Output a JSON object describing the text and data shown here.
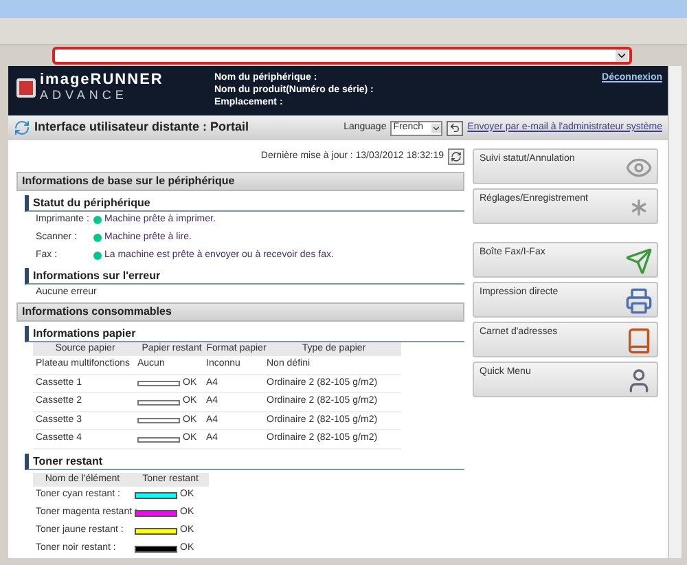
{
  "header": {
    "logo_top": "imageRUNNER",
    "logo_bottom": "ADVANCE",
    "device_fields": [
      "Nom du périphérique :",
      "Nom du produit(Numéro de série) :",
      "Emplacement :"
    ],
    "logout_link": "Déconnexion"
  },
  "title_bar": {
    "title": "Interface utilisateur distante : Portail",
    "language_label": "Language",
    "language_value": "French",
    "admin_link": "Envoyer par e-mail à l'administrateur système"
  },
  "last_update": "Dernière mise à jour : 13/03/2012 18:32:19",
  "basic_info": {
    "title": "Informations de base sur le périphérique",
    "status_title": "Statut du périphérique",
    "status_rows": [
      {
        "label": "Imprimante :",
        "value": "Machine prête à imprimer."
      },
      {
        "label": "Scanner :",
        "value": "Machine prête à lire."
      },
      {
        "label": "Fax :",
        "value": "La machine est prête à envoyer ou à recevoir des fax."
      }
    ],
    "error_title": "Informations sur l'erreur",
    "error_text": "Aucune erreur"
  },
  "consumables": {
    "title": "Informations consommables",
    "paper_title": "Informations papier",
    "paper_columns": [
      "Source papier",
      "Papier restant",
      "Format papier",
      "Type de papier"
    ],
    "paper_rows": [
      {
        "source": "Plateau multifonctions",
        "remaining": "Aucun",
        "kind": "text",
        "format": "Inconnu",
        "type": "Non défini"
      },
      {
        "source": "Cassette 1",
        "remaining": "OK",
        "kind": "bar",
        "format": "A4",
        "type": "Ordinaire 2 (82-105 g/m2)"
      },
      {
        "source": "Cassette 2",
        "remaining": "OK",
        "kind": "bar",
        "format": "A4",
        "type": "Ordinaire 2 (82-105 g/m2)"
      },
      {
        "source": "Cassette 3",
        "remaining": "OK",
        "kind": "bar",
        "format": "A4",
        "type": "Ordinaire 2 (82-105 g/m2)"
      },
      {
        "source": "Cassette 4",
        "remaining": "OK",
        "kind": "bar",
        "format": "A4",
        "type": "Ordinaire 2 (82-105 g/m2)"
      }
    ],
    "toner_title": "Toner restant",
    "toner_columns": [
      "Nom de l'élément",
      "Toner restant"
    ],
    "toner_rows": [
      {
        "name": "Toner cyan restant :",
        "color": "#00ffff",
        "reading": "OK"
      },
      {
        "name": "Toner magenta restant :",
        "color": "#ff00ff",
        "reading": "OK"
      },
      {
        "name": "Toner jaune restant :",
        "color": "#ffff00",
        "reading": "OK"
      },
      {
        "name": "Toner noir restant :",
        "color": "#000000",
        "reading": "OK"
      }
    ]
  },
  "menu_buttons": [
    {
      "label": "Suivi statut/Annulation",
      "kind": "status"
    },
    {
      "label": "Réglages/Enregistrement",
      "kind": "settings"
    },
    {
      "label": "Boîte Fax/I-Fax",
      "kind": "fax"
    },
    {
      "label": "Impression directe",
      "kind": "print"
    },
    {
      "label": "Carnet d'adresses",
      "kind": "address"
    },
    {
      "label": "Quick Menu",
      "kind": "quick"
    }
  ]
}
